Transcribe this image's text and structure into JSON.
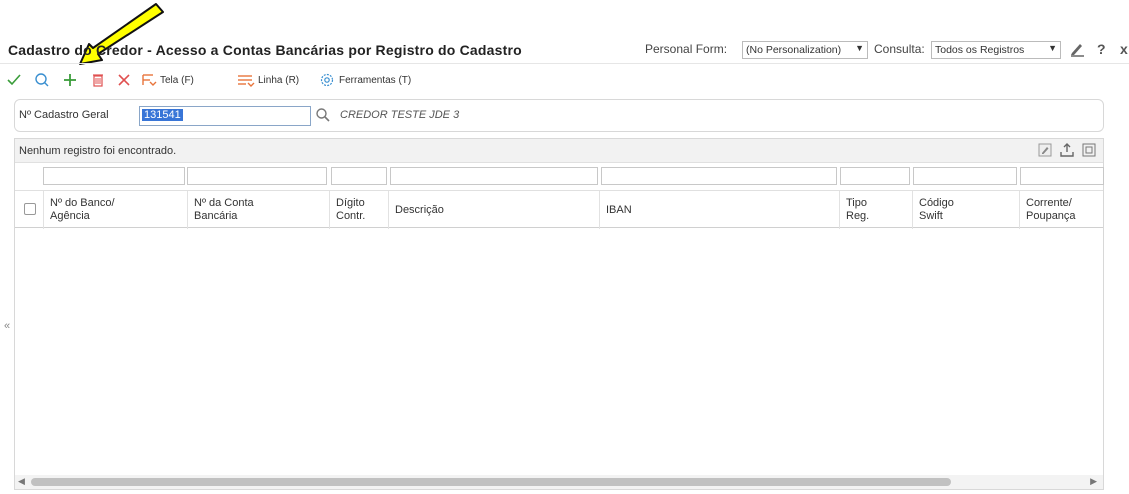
{
  "title": "Cadastro do Credor - Acesso a Contas Bancárias por Registro do Cadastro",
  "personal_form": {
    "label": "Personal Form:",
    "value": "(No Personalization)"
  },
  "consulta": {
    "label": "Consulta:",
    "value": "Todos os Registros"
  },
  "title_icons": {
    "edit": "pencil-icon",
    "help": "?",
    "close": "x"
  },
  "toolbar": {
    "ok": "checkmark-icon",
    "find": "search-icon",
    "add": "plus-icon",
    "delete": "trash-icon",
    "cancel": "close-icon",
    "tela_label": "Tela (F)",
    "linha_label": "Linha (R)",
    "ferramentas_label": "Ferramentas (T)"
  },
  "header": {
    "field_label": "Nº Cadastro Geral",
    "field_value": "131541",
    "description": "CREDOR TESTE JDE 3"
  },
  "grid": {
    "message": "Nenhum registro foi encontrado.",
    "columns": [
      {
        "line1": "Nº do Banco/",
        "line2": "Agência"
      },
      {
        "line1": "Nº da Conta",
        "line2": "Bancária"
      },
      {
        "line1": "Dígito",
        "line2": "Contr."
      },
      {
        "line1": "Descrição",
        "line2": ""
      },
      {
        "line1": "IBAN",
        "line2": ""
      },
      {
        "line1": "Tipo",
        "line2": "Reg."
      },
      {
        "line1": "Código",
        "line2": "Swift"
      },
      {
        "line1": "Corrente/",
        "line2": "Poupança"
      }
    ]
  },
  "colors": {
    "accent_green": "#3a9d3a",
    "delete_red": "#e05050",
    "orange": "#e8743b",
    "selection": "#3875d7",
    "annotation_arrow": "#ffff00"
  }
}
